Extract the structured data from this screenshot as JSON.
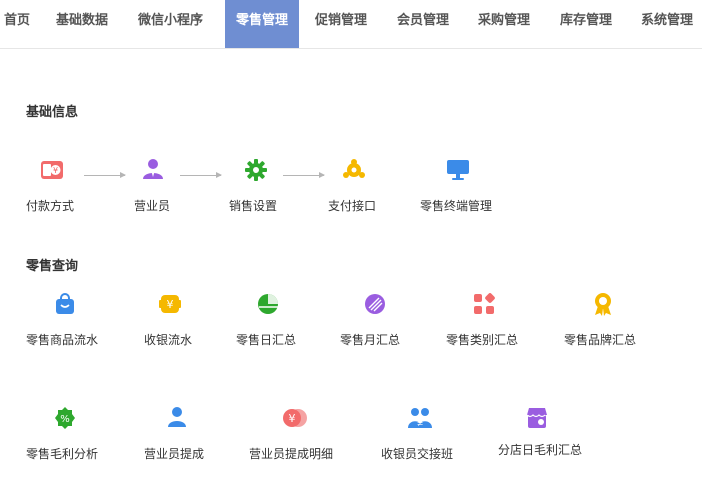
{
  "nav": {
    "tabs": [
      "首页",
      "基础数据",
      "微信小程序",
      "零售管理",
      "促销管理",
      "会员管理",
      "采购管理",
      "库存管理",
      "系统管理"
    ],
    "active_tab": "零售管理",
    "active_color": "#6f8ed2"
  },
  "basic": {
    "title": "基础信息",
    "items": [
      {
        "label": "付款方式",
        "icon": "payment-card-icon"
      },
      {
        "label": "营业员",
        "icon": "salesperson-icon"
      },
      {
        "label": "销售设置",
        "icon": "gear-icon"
      },
      {
        "label": "支付接口",
        "icon": "payment-interface-icon"
      },
      {
        "label": "零售终端管理",
        "icon": "monitor-icon"
      }
    ]
  },
  "query": {
    "title": "零售查询",
    "items": [
      {
        "label": "零售商品流水",
        "icon": "shopping-bag-icon"
      },
      {
        "label": "收银流水",
        "icon": "cashier-yen-icon"
      },
      {
        "label": "零售日汇总",
        "icon": "daily-chart-icon"
      },
      {
        "label": "零售月汇总",
        "icon": "monthly-chart-icon"
      },
      {
        "label": "零售类别汇总",
        "icon": "category-grid-icon"
      },
      {
        "label": "零售品牌汇总",
        "icon": "brand-medal-icon"
      },
      {
        "label": "零售毛利分析",
        "icon": "percent-badge-icon"
      },
      {
        "label": "营业员提成",
        "icon": "person-icon"
      },
      {
        "label": "营业员提成明细",
        "icon": "coins-icon"
      },
      {
        "label": "收银员交接班",
        "icon": "shift-handover-icon"
      },
      {
        "label": "分店日毛利汇总",
        "icon": "store-icon"
      }
    ]
  }
}
